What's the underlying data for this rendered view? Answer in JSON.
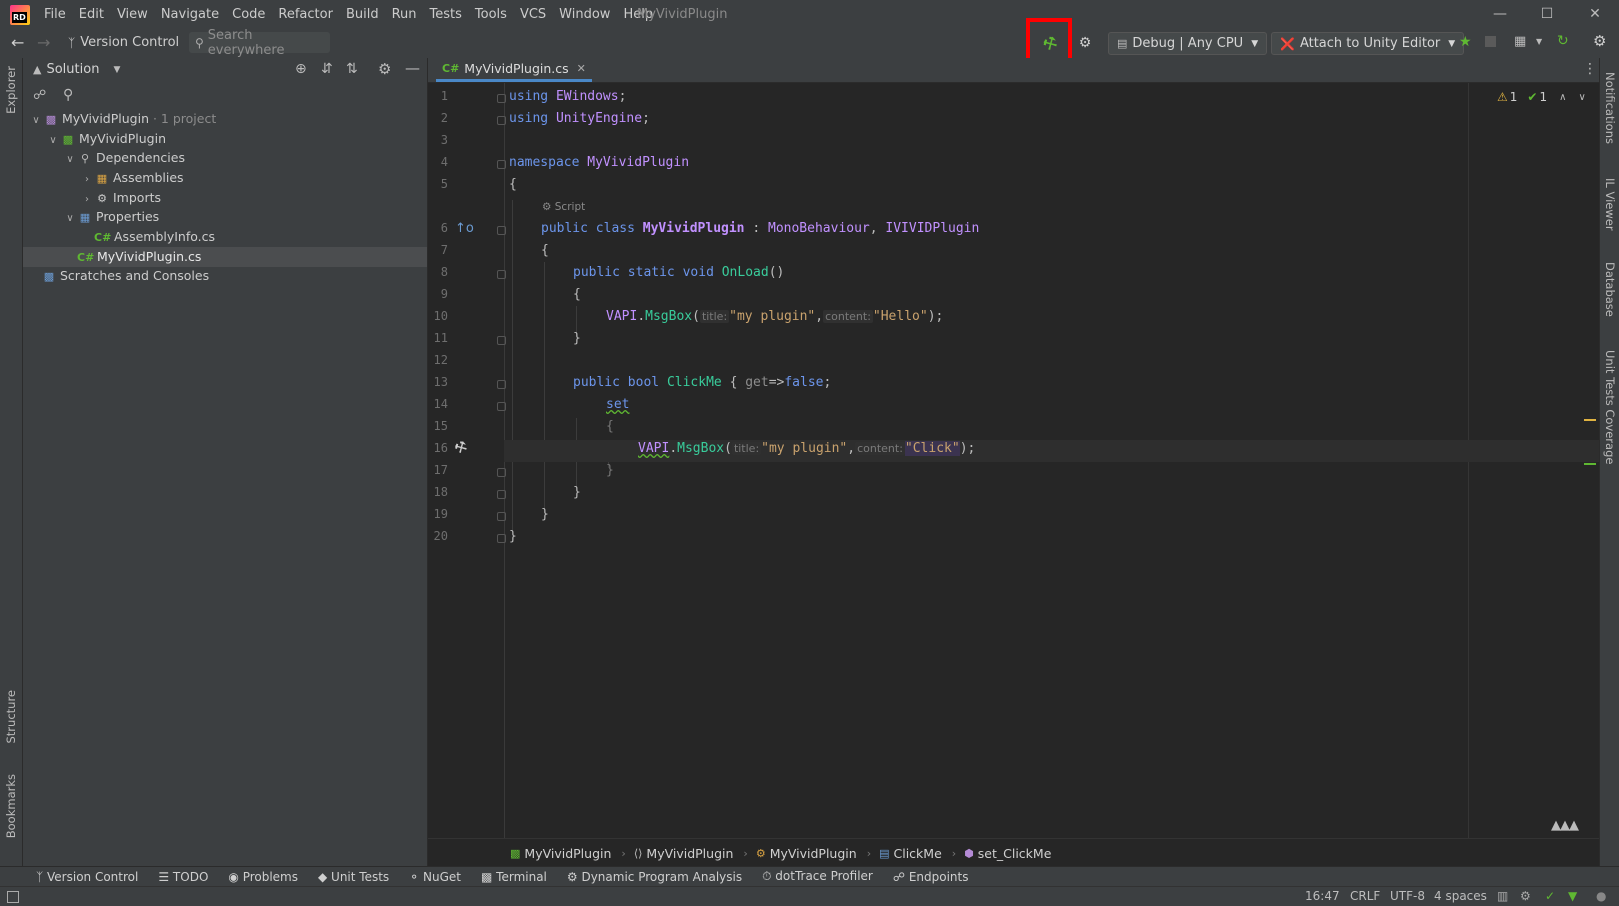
{
  "app": {
    "logo_text": "RD",
    "title": "MyVividPlugin",
    "menu": [
      "File",
      "Edit",
      "View",
      "Navigate",
      "Code",
      "Refactor",
      "Build",
      "Run",
      "Tests",
      "Tools",
      "VCS",
      "Window",
      "Help"
    ]
  },
  "toolbar": {
    "version_control": "Version Control",
    "search_placeholder": "Search everywhere",
    "config": "Debug | Any CPU",
    "attach": "Attach to Unity Editor"
  },
  "left_stripe": {
    "top": "Explorer",
    "structure": "Structure",
    "bookmarks": "Bookmarks"
  },
  "explorer": {
    "header": "Solution",
    "tree": [
      {
        "label": "MyVividPlugin",
        "suffix": "· 1 project",
        "depth": 0,
        "expanded": true,
        "icon": "solution-icon"
      },
      {
        "label": "MyVividPlugin",
        "suffix": "",
        "depth": 1,
        "expanded": true,
        "icon": "project-icon"
      },
      {
        "label": "Dependencies",
        "suffix": "",
        "depth": 2,
        "expanded": true,
        "icon": "dependencies-icon"
      },
      {
        "label": "Assemblies",
        "suffix": "",
        "depth": 3,
        "expanded": false,
        "icon": "assemblies-icon"
      },
      {
        "label": "Imports",
        "suffix": "",
        "depth": 3,
        "expanded": false,
        "icon": "gear-icon"
      },
      {
        "label": "Properties",
        "suffix": "",
        "depth": 2,
        "expanded": true,
        "icon": "folder-icon"
      },
      {
        "label": "AssemblyInfo.cs",
        "suffix": "",
        "depth": 3,
        "expanded": null,
        "icon": "csharp-file-icon"
      },
      {
        "label": "MyVividPlugin.cs",
        "suffix": "",
        "depth": 2,
        "expanded": null,
        "icon": "csharp-file-icon",
        "selected": true
      },
      {
        "label": "Scratches and Consoles",
        "suffix": "",
        "depth": 0,
        "expanded": null,
        "icon": "scratches-icon"
      }
    ]
  },
  "editor": {
    "tab_prefix": "C#",
    "tab_label": "MyVividPlugin.cs",
    "inspection": {
      "warnings": "1",
      "ok": "1"
    },
    "script_hint": "Script",
    "line_numbers": [
      "1",
      "2",
      "3",
      "4",
      "5",
      "6",
      "7",
      "8",
      "9",
      "10",
      "11",
      "12",
      "13",
      "14",
      "15",
      "16",
      "17",
      "18",
      "19",
      "20"
    ],
    "code": {
      "l1": [
        "using",
        "EWindows",
        ";"
      ],
      "l2": [
        "using",
        "UnityEngine",
        ";"
      ],
      "l4": [
        "namespace",
        "MyVividPlugin"
      ],
      "l5": "{",
      "l6": [
        "public",
        "class",
        "MyVividPlugin",
        ":",
        "MonoBehaviour",
        ",",
        "IVIVIDPlugin"
      ],
      "l7": "{",
      "l8": [
        "public",
        "static",
        "void",
        "OnLoad",
        "()"
      ],
      "l9": "{",
      "l10": [
        "VAPI",
        ".",
        "MsgBox",
        "(",
        "title:",
        "\"my plugin\"",
        ",",
        "content:",
        "\"Hello\"",
        ");"
      ],
      "l11": "}",
      "l13": [
        "public",
        "bool",
        "ClickMe",
        "{",
        "get",
        "=>",
        "false",
        ";"
      ],
      "l14": "set",
      "l15": "{",
      "l16": [
        "VAPI",
        ".",
        "MsgBox",
        "(",
        "title:",
        "\"my plugin\"",
        ",",
        "content:",
        "\"Click\"",
        ");"
      ],
      "l17": "}",
      "l18": "}",
      "l19": "}",
      "l20": "}"
    }
  },
  "breadcrumb": [
    "MyVividPlugin",
    "MyVividPlugin",
    "MyVividPlugin",
    "ClickMe",
    "set_ClickMe"
  ],
  "right_stripe": [
    "Notifications",
    "IL Viewer",
    "Database",
    "Unit Tests Coverage"
  ],
  "bottom_tools": [
    "Version Control",
    "TODO",
    "Problems",
    "Unit Tests",
    "NuGet",
    "Terminal",
    "Dynamic Program Analysis",
    "dotTrace Profiler",
    "Endpoints"
  ],
  "status": {
    "position": "16:47",
    "line_sep": "CRLF",
    "encoding": "UTF-8",
    "indent": "4 spaces"
  },
  "colors": {
    "highlight_box": "#ff0000",
    "build_icon": "#5fb832",
    "accent": "#4a88c7"
  }
}
